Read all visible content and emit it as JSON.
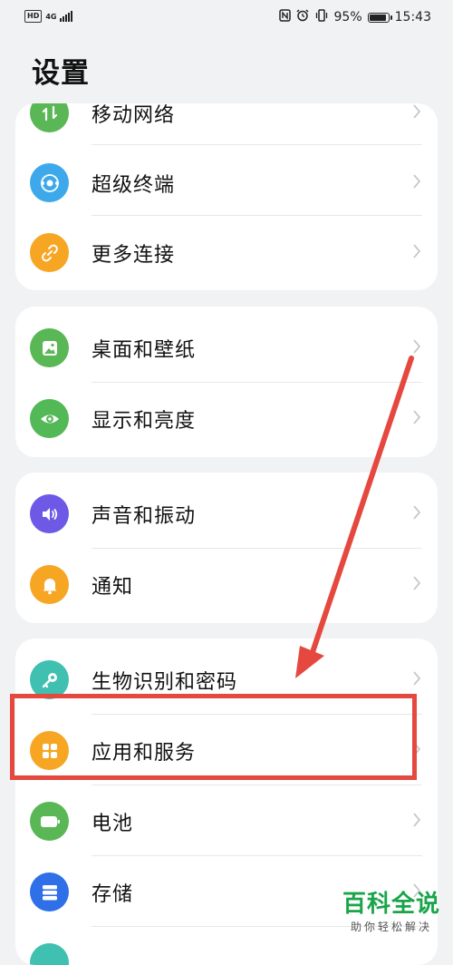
{
  "status_bar": {
    "left_badge": "HD",
    "network_type": "4G",
    "battery_percent": "95%",
    "battery_level": 0.95,
    "time": "15:43",
    "icons": [
      "nfc-icon",
      "alarm-icon",
      "vibrate-icon"
    ]
  },
  "page": {
    "title": "设置"
  },
  "groups": [
    {
      "items": [
        {
          "label": "移动网络",
          "icon": "mobile-network-icon",
          "color": "#5ab756"
        },
        {
          "label": "超级终端",
          "icon": "super-device-icon",
          "color": "#3ea9ea"
        },
        {
          "label": "更多连接",
          "icon": "link-icon",
          "color": "#f6a623"
        }
      ]
    },
    {
      "items": [
        {
          "label": "桌面和壁纸",
          "icon": "wallpaper-icon",
          "color": "#5ab756"
        },
        {
          "label": "显示和亮度",
          "icon": "eye-icon",
          "color": "#53b856"
        }
      ]
    },
    {
      "items": [
        {
          "label": "声音和振动",
          "icon": "speaker-icon",
          "color": "#6c5ae6"
        },
        {
          "label": "通知",
          "icon": "bell-icon",
          "color": "#f6a623"
        }
      ]
    },
    {
      "items": [
        {
          "label": "生物识别和密码",
          "icon": "key-icon",
          "color": "#3fc0b0"
        },
        {
          "label": "应用和服务",
          "icon": "apps-icon",
          "color": "#f6a623"
        },
        {
          "label": "电池",
          "icon": "battery-icon",
          "color": "#5ab756"
        },
        {
          "label": "存储",
          "icon": "storage-icon",
          "color": "#2f6fe8"
        }
      ]
    }
  ],
  "overlay": {
    "accent_color": "#e5483e",
    "highlighted_item": "应用和服务"
  },
  "watermark": {
    "main": "百科全说",
    "sub": "助你轻松解决"
  }
}
